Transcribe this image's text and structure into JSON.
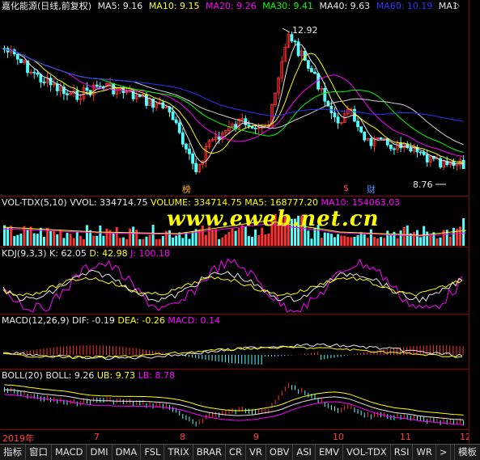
{
  "main": {
    "title": "嘉化能源(日线,前复权)",
    "ma5": "MA5: 9.16",
    "ma10": "MA10: 9.15",
    "ma20": "MA20: 9.26",
    "ma30": "MA30: 9.41",
    "ma40": "MA40: 9.63",
    "ma60": "MA60: 10.19",
    "ma_more": "MA1",
    "high_label": "12.92",
    "low_label": "8.76",
    "tag_bang": "榜",
    "tag_s": "$",
    "tag_cai": "财"
  },
  "vol": {
    "name": "VOL-TDX(5,10)",
    "vvol": "VVOL: 334714.75",
    "volume": "VOLUME: 334714.75",
    "ma5": "MA5: 168777.20",
    "ma10": "MA10: 154063.03"
  },
  "watermark": "www.eweb.net.cn",
  "kdj": {
    "name": "KDJ(9,3,3)",
    "k": "K: 62.05",
    "d": "D: 42.98",
    "j": "J: 100.18"
  },
  "macd": {
    "name": "MACD(12,26,9)",
    "dif": "DIF: -0.19",
    "dea": "DEA: -0.26",
    "macd": "MACD: 0.14"
  },
  "boll": {
    "name": "BOLL(20)",
    "boll": "BOLL: 9.26",
    "ub": "UB: 9.73",
    "lb": "LB: 8.78"
  },
  "dates": [
    "2019年",
    "7",
    "8",
    "9",
    "10",
    "11",
    "12"
  ],
  "tabs": [
    "指标",
    "窗口",
    "MACD",
    "DMI",
    "DMA",
    "FSL",
    "TRIX",
    "BRAR",
    "CR",
    "VR",
    "OBV",
    "ASI",
    "EMV",
    "VOL-TDX",
    "RSI",
    "WR",
    ">"
  ],
  "template_tab": "模板",
  "colors": {
    "up": "#ff3232",
    "down": "#54ffff",
    "grid": "#8b0000"
  }
}
